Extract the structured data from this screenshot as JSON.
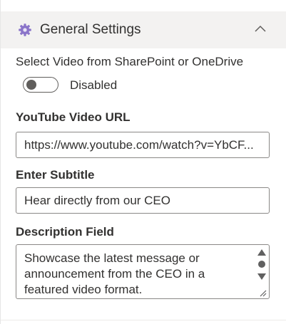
{
  "section": {
    "title": "General Settings",
    "icon": "gear-icon",
    "collapse_icon": "chevron-up-icon",
    "expanded": true
  },
  "video_source_toggle": {
    "label": "Select Video from SharePoint or OneDrive",
    "state_text": "Disabled",
    "checked": false
  },
  "youtube_url": {
    "label": "YouTube Video URL",
    "value": "https://www.youtube.com/watch?v=YbCF..."
  },
  "subtitle": {
    "label": "Enter Subtitle",
    "value": "Hear directly from our CEO"
  },
  "description": {
    "label": "Description Field",
    "value": "Showcase the latest message or announcement from the CEO in a featured video format."
  },
  "colors": {
    "header_bg": "#f3f2f1",
    "text": "#323130",
    "border": "#8a8886",
    "gear": "#8a74c9"
  }
}
